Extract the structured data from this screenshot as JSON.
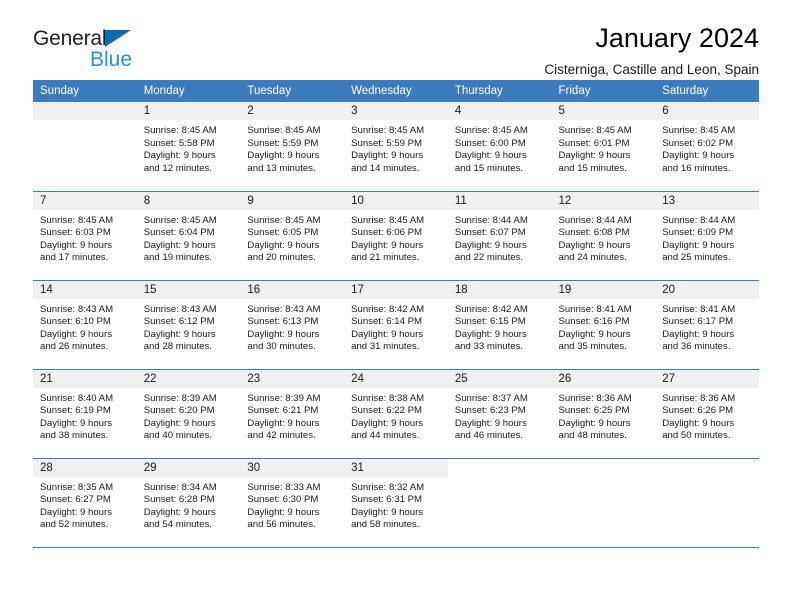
{
  "brand": {
    "word1": "General",
    "word2": "Blue",
    "triangle_color": "#0d6bb0",
    "word2_color": "#2b8fd4"
  },
  "header": {
    "title": "January 2024",
    "subtitle": "Cisterniga, Castille and Leon, Spain"
  },
  "calendar": {
    "header_bg": "#3a7cbe",
    "daynum_bg": "#f0f0f0",
    "weekdays": [
      "Sunday",
      "Monday",
      "Tuesday",
      "Wednesday",
      "Thursday",
      "Friday",
      "Saturday"
    ],
    "weeks": [
      [
        {
          "day": "",
          "sunrise": "",
          "sunset": "",
          "daylight1": "",
          "daylight2": "",
          "empty": true
        },
        {
          "day": "1",
          "sunrise": "Sunrise: 8:45 AM",
          "sunset": "Sunset: 5:58 PM",
          "daylight1": "Daylight: 9 hours",
          "daylight2": "and 12 minutes."
        },
        {
          "day": "2",
          "sunrise": "Sunrise: 8:45 AM",
          "sunset": "Sunset: 5:59 PM",
          "daylight1": "Daylight: 9 hours",
          "daylight2": "and 13 minutes."
        },
        {
          "day": "3",
          "sunrise": "Sunrise: 8:45 AM",
          "sunset": "Sunset: 5:59 PM",
          "daylight1": "Daylight: 9 hours",
          "daylight2": "and 14 minutes."
        },
        {
          "day": "4",
          "sunrise": "Sunrise: 8:45 AM",
          "sunset": "Sunset: 6:00 PM",
          "daylight1": "Daylight: 9 hours",
          "daylight2": "and 15 minutes."
        },
        {
          "day": "5",
          "sunrise": "Sunrise: 8:45 AM",
          "sunset": "Sunset: 6:01 PM",
          "daylight1": "Daylight: 9 hours",
          "daylight2": "and 15 minutes."
        },
        {
          "day": "6",
          "sunrise": "Sunrise: 8:45 AM",
          "sunset": "Sunset: 6:02 PM",
          "daylight1": "Daylight: 9 hours",
          "daylight2": "and 16 minutes."
        }
      ],
      [
        {
          "day": "7",
          "sunrise": "Sunrise: 8:45 AM",
          "sunset": "Sunset: 6:03 PM",
          "daylight1": "Daylight: 9 hours",
          "daylight2": "and 17 minutes."
        },
        {
          "day": "8",
          "sunrise": "Sunrise: 8:45 AM",
          "sunset": "Sunset: 6:04 PM",
          "daylight1": "Daylight: 9 hours",
          "daylight2": "and 19 minutes."
        },
        {
          "day": "9",
          "sunrise": "Sunrise: 8:45 AM",
          "sunset": "Sunset: 6:05 PM",
          "daylight1": "Daylight: 9 hours",
          "daylight2": "and 20 minutes."
        },
        {
          "day": "10",
          "sunrise": "Sunrise: 8:45 AM",
          "sunset": "Sunset: 6:06 PM",
          "daylight1": "Daylight: 9 hours",
          "daylight2": "and 21 minutes."
        },
        {
          "day": "11",
          "sunrise": "Sunrise: 8:44 AM",
          "sunset": "Sunset: 6:07 PM",
          "daylight1": "Daylight: 9 hours",
          "daylight2": "and 22 minutes."
        },
        {
          "day": "12",
          "sunrise": "Sunrise: 8:44 AM",
          "sunset": "Sunset: 6:08 PM",
          "daylight1": "Daylight: 9 hours",
          "daylight2": "and 24 minutes."
        },
        {
          "day": "13",
          "sunrise": "Sunrise: 8:44 AM",
          "sunset": "Sunset: 6:09 PM",
          "daylight1": "Daylight: 9 hours",
          "daylight2": "and 25 minutes."
        }
      ],
      [
        {
          "day": "14",
          "sunrise": "Sunrise: 8:43 AM",
          "sunset": "Sunset: 6:10 PM",
          "daylight1": "Daylight: 9 hours",
          "daylight2": "and 26 minutes."
        },
        {
          "day": "15",
          "sunrise": "Sunrise: 8:43 AM",
          "sunset": "Sunset: 6:12 PM",
          "daylight1": "Daylight: 9 hours",
          "daylight2": "and 28 minutes."
        },
        {
          "day": "16",
          "sunrise": "Sunrise: 8:43 AM",
          "sunset": "Sunset: 6:13 PM",
          "daylight1": "Daylight: 9 hours",
          "daylight2": "and 30 minutes."
        },
        {
          "day": "17",
          "sunrise": "Sunrise: 8:42 AM",
          "sunset": "Sunset: 6:14 PM",
          "daylight1": "Daylight: 9 hours",
          "daylight2": "and 31 minutes."
        },
        {
          "day": "18",
          "sunrise": "Sunrise: 8:42 AM",
          "sunset": "Sunset: 6:15 PM",
          "daylight1": "Daylight: 9 hours",
          "daylight2": "and 33 minutes."
        },
        {
          "day": "19",
          "sunrise": "Sunrise: 8:41 AM",
          "sunset": "Sunset: 6:16 PM",
          "daylight1": "Daylight: 9 hours",
          "daylight2": "and 35 minutes."
        },
        {
          "day": "20",
          "sunrise": "Sunrise: 8:41 AM",
          "sunset": "Sunset: 6:17 PM",
          "daylight1": "Daylight: 9 hours",
          "daylight2": "and 36 minutes."
        }
      ],
      [
        {
          "day": "21",
          "sunrise": "Sunrise: 8:40 AM",
          "sunset": "Sunset: 6:19 PM",
          "daylight1": "Daylight: 9 hours",
          "daylight2": "and 38 minutes."
        },
        {
          "day": "22",
          "sunrise": "Sunrise: 8:39 AM",
          "sunset": "Sunset: 6:20 PM",
          "daylight1": "Daylight: 9 hours",
          "daylight2": "and 40 minutes."
        },
        {
          "day": "23",
          "sunrise": "Sunrise: 8:39 AM",
          "sunset": "Sunset: 6:21 PM",
          "daylight1": "Daylight: 9 hours",
          "daylight2": "and 42 minutes."
        },
        {
          "day": "24",
          "sunrise": "Sunrise: 8:38 AM",
          "sunset": "Sunset: 6:22 PM",
          "daylight1": "Daylight: 9 hours",
          "daylight2": "and 44 minutes."
        },
        {
          "day": "25",
          "sunrise": "Sunrise: 8:37 AM",
          "sunset": "Sunset: 6:23 PM",
          "daylight1": "Daylight: 9 hours",
          "daylight2": "and 46 minutes."
        },
        {
          "day": "26",
          "sunrise": "Sunrise: 8:36 AM",
          "sunset": "Sunset: 6:25 PM",
          "daylight1": "Daylight: 9 hours",
          "daylight2": "and 48 minutes."
        },
        {
          "day": "27",
          "sunrise": "Sunrise: 8:36 AM",
          "sunset": "Sunset: 6:26 PM",
          "daylight1": "Daylight: 9 hours",
          "daylight2": "and 50 minutes."
        }
      ],
      [
        {
          "day": "28",
          "sunrise": "Sunrise: 8:35 AM",
          "sunset": "Sunset: 6:27 PM",
          "daylight1": "Daylight: 9 hours",
          "daylight2": "and 52 minutes."
        },
        {
          "day": "29",
          "sunrise": "Sunrise: 8:34 AM",
          "sunset": "Sunset: 6:28 PM",
          "daylight1": "Daylight: 9 hours",
          "daylight2": "and 54 minutes."
        },
        {
          "day": "30",
          "sunrise": "Sunrise: 8:33 AM",
          "sunset": "Sunset: 6:30 PM",
          "daylight1": "Daylight: 9 hours",
          "daylight2": "and 56 minutes."
        },
        {
          "day": "31",
          "sunrise": "Sunrise: 8:32 AM",
          "sunset": "Sunset: 6:31 PM",
          "daylight1": "Daylight: 9 hours",
          "daylight2": "and 58 minutes."
        },
        {
          "day": "",
          "sunrise": "",
          "sunset": "",
          "daylight1": "",
          "daylight2": "",
          "empty": true,
          "blank": true
        },
        {
          "day": "",
          "sunrise": "",
          "sunset": "",
          "daylight1": "",
          "daylight2": "",
          "empty": true,
          "blank": true
        },
        {
          "day": "",
          "sunrise": "",
          "sunset": "",
          "daylight1": "",
          "daylight2": "",
          "empty": true,
          "blank": true
        }
      ]
    ]
  }
}
